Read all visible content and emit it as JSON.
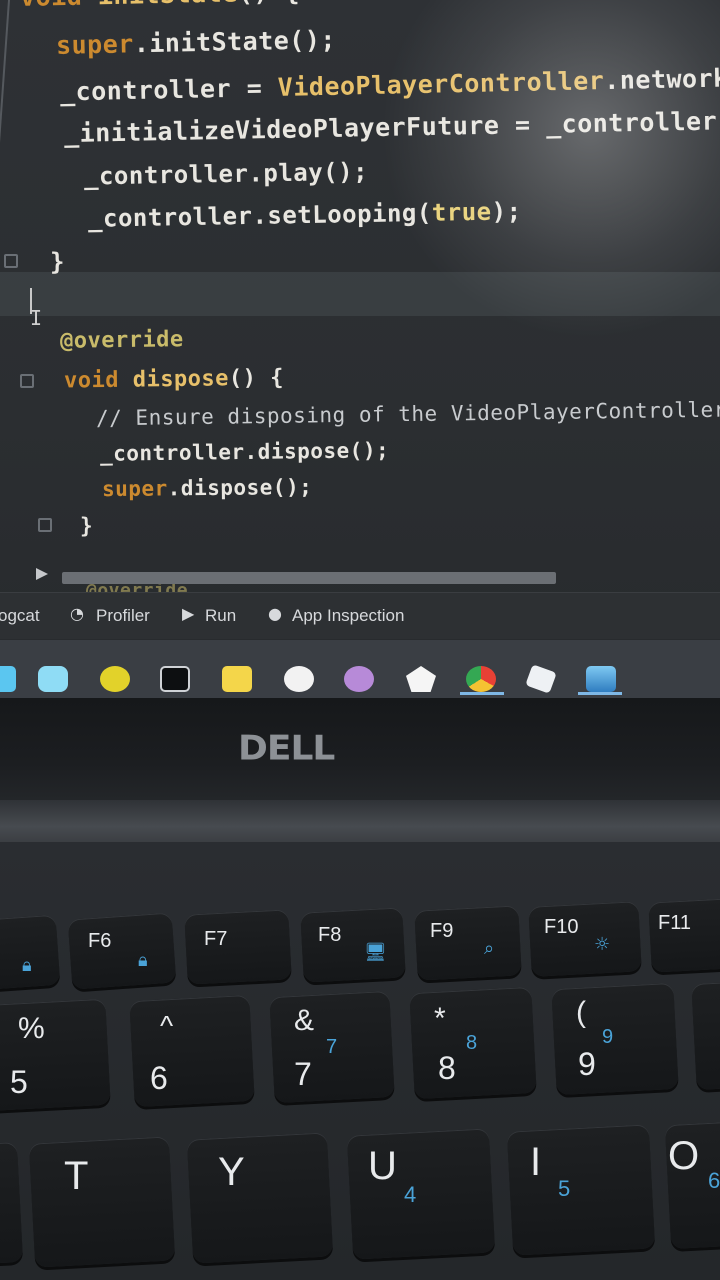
{
  "photo": {
    "code_lines": [
      {
        "id": "line-init-sig",
        "parts": [
          [
            "kw",
            "void "
          ],
          [
            "fn",
            "initState"
          ],
          [
            "ty",
            "() {"
          ]
        ]
      },
      {
        "id": "line-super-init",
        "parts": [
          [
            "kw",
            "super"
          ],
          [
            "ty",
            ".initState();"
          ]
        ]
      },
      {
        "id": "line-controller",
        "parts": [
          [
            "ty",
            "_controller = "
          ],
          [
            "fn",
            "VideoPlayerController"
          ],
          [
            "ty",
            ".network(wi"
          ]
        ]
      },
      {
        "id": "line-future",
        "parts": [
          [
            "ty",
            "_initializeVideoPlayerFuture = _controller.init"
          ]
        ]
      },
      {
        "id": "line-play",
        "parts": [
          [
            "ty",
            "_controller.play();"
          ]
        ]
      },
      {
        "id": "line-looping",
        "parts": [
          [
            "ty",
            "_controller.setLooping("
          ],
          [
            "kw2",
            "true"
          ],
          [
            "ty",
            ");"
          ]
        ]
      },
      {
        "id": "line-close-1",
        "parts": [
          [
            "ty",
            "}"
          ]
        ]
      },
      {
        "id": "line-override",
        "parts": [
          [
            "anno",
            "@override"
          ]
        ]
      },
      {
        "id": "line-dispose-sig",
        "parts": [
          [
            "kw",
            "void "
          ],
          [
            "fn",
            "dispose"
          ],
          [
            "ty",
            "() {"
          ]
        ]
      },
      {
        "id": "line-comment",
        "parts": [
          [
            "cm",
            "// Ensure disposing of the VideoPlayerController"
          ]
        ]
      },
      {
        "id": "line-controller-dispose",
        "parts": [
          [
            "ty",
            "_controller.dispose();"
          ]
        ]
      },
      {
        "id": "line-super-dispose",
        "parts": [
          [
            "kw",
            "super"
          ],
          [
            "ty",
            ".dispose();"
          ]
        ]
      },
      {
        "id": "line-close-2",
        "parts": [
          [
            "ty",
            "}"
          ]
        ]
      },
      {
        "id": "line-override-2",
        "parts": [
          [
            "anno",
            "@override"
          ]
        ]
      }
    ],
    "tool_tabs": {
      "logcat": "ogcat",
      "profiler": "Profiler",
      "run": "Run",
      "app_inspection": "App Inspection"
    },
    "laptop_brand": "DELL",
    "keys": {
      "f6": "F6",
      "f7": "F7",
      "f8": "F8",
      "f9": "F9",
      "f10": "F10",
      "f11": "F11",
      "k5_top": "%",
      "k5": "5",
      "k6_top": "^",
      "k6": "6",
      "k7_top": "&",
      "k7": "7",
      "k7_num": "7",
      "k8_top": "*",
      "k8": "8",
      "k8_num": "8",
      "k9_top": "(",
      "k9": "9",
      "k9_num": "9",
      "kt": "T",
      "ky": "Y",
      "ku": "U",
      "ku_num": "4",
      "ki": "I",
      "ki_num": "5",
      "ko": "O",
      "ko_num": "6"
    },
    "colors": {
      "keyword": "#cc8a2f",
      "function": "#e7c06a",
      "key_fn_accent": "#4aa3d8"
    }
  }
}
